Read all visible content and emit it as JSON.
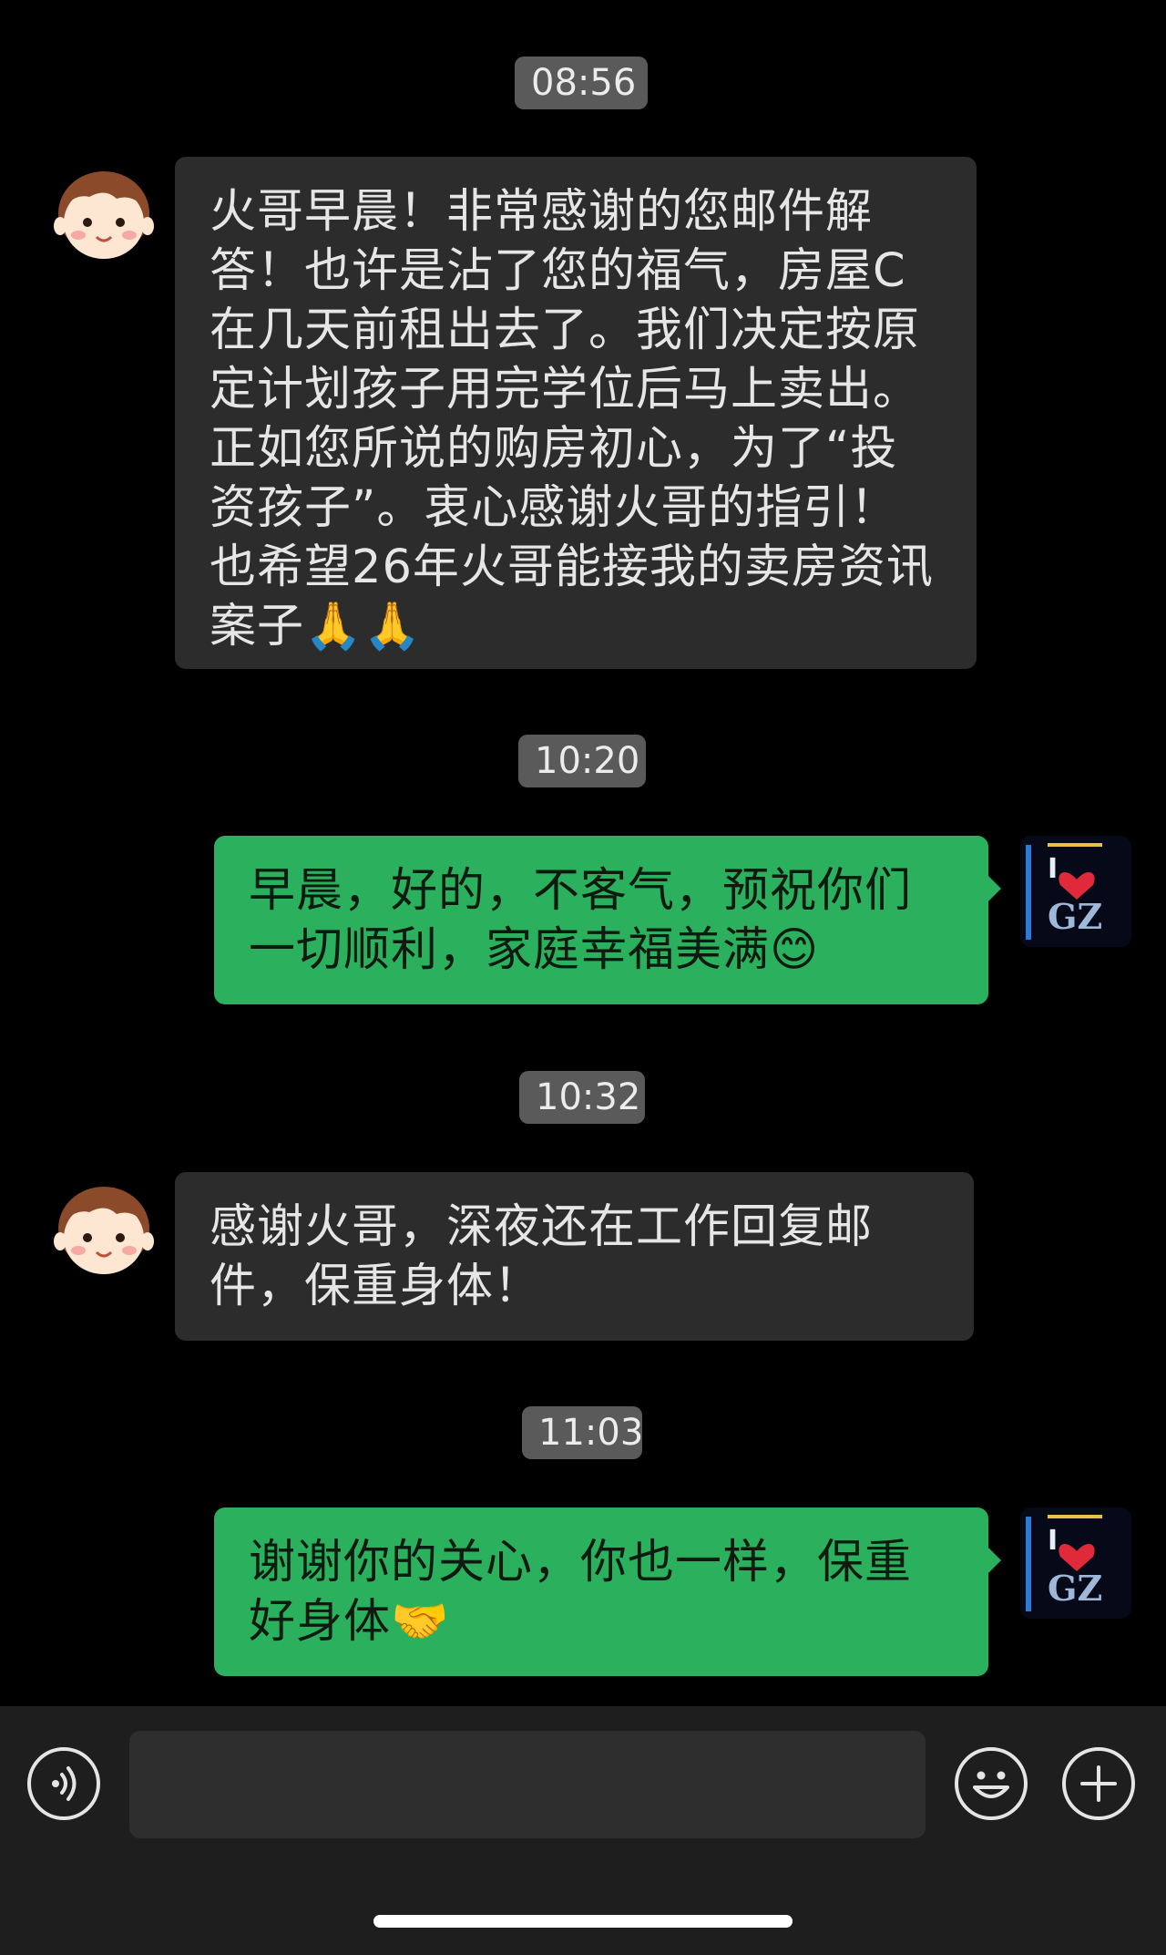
{
  "messages": [
    {
      "time": "08:56",
      "sender": "friend",
      "text": "火哥早晨！非常感谢的您邮件解答！也许是沾了您的福气，房屋C在几天前租出去了。我们决定按原定计划孩子用完学位后马上卖出。正如您所说的购房初心，为了“投资孩子”。衷心感谢火哥的指引！也希望26年火哥能接我的卖房资讯案子",
      "emoji": "🙏🙏"
    },
    {
      "time": "10:20",
      "sender": "me",
      "text": "早晨，好的，不客气，预祝你们一切顺利，家庭幸福美满",
      "emoji": "😊"
    },
    {
      "time": "10:32",
      "sender": "friend",
      "text": "感谢火哥，深夜还在工作回复邮件，保重身体！",
      "emoji": ""
    },
    {
      "time": "11:03",
      "sender": "me",
      "text": "谢谢你的关心，你也一样，保重好身体",
      "emoji": "🤝"
    }
  ],
  "self_avatar_text": "I GZ",
  "colors": {
    "background": "#000000",
    "incoming_bubble": "#2c2c2c",
    "outgoing_bubble": "#2bb05e",
    "time_pill": "#5a5a5a",
    "input_bar": "#1e1e1e"
  },
  "icons": {
    "voice": "voice-input-icon",
    "emoji": "emoji-icon",
    "plus": "plus-icon"
  }
}
